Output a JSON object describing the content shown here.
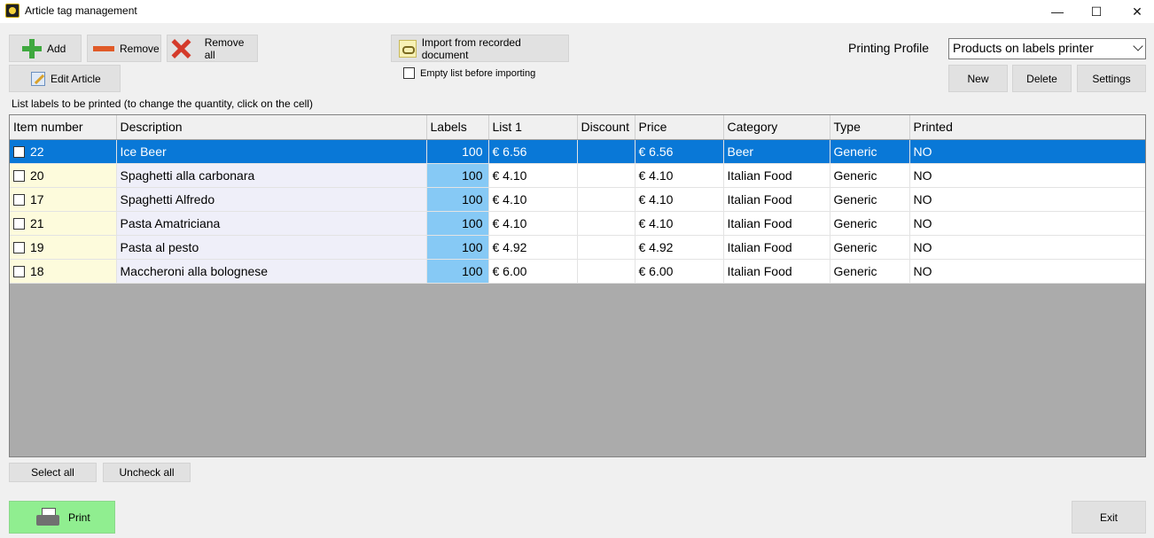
{
  "window": {
    "title": "Article tag management",
    "minimize": "—",
    "maximize": "☐",
    "close": "✕"
  },
  "toolbar": {
    "add": "Add",
    "remove": "Remove",
    "remove_all": "Remove all",
    "edit_article": "Edit Article",
    "import": "Import from recorded document",
    "empty_list": "Empty list before importing"
  },
  "profile": {
    "label": "Printing Profile",
    "selected": "Products on labels printer",
    "new": "New",
    "delete": "Delete",
    "settings": "Settings"
  },
  "list_caption": "List labels to be printed (to change the quantity, click on the cell)",
  "table": {
    "headers": [
      "Item number",
      "Description",
      "Labels",
      "List 1",
      "Discount",
      "Price",
      "Category",
      "Type",
      "Printed"
    ],
    "rows": [
      {
        "item": "22",
        "desc": "Ice Beer",
        "labels": "100",
        "list1": "€ 6.56",
        "discount": "",
        "price": "€ 6.56",
        "category": "Beer",
        "type": "Generic",
        "printed": "NO"
      },
      {
        "item": "20",
        "desc": "Spaghetti alla carbonara",
        "labels": "100",
        "list1": "€ 4.10",
        "discount": "",
        "price": "€ 4.10",
        "category": "Italian Food",
        "type": "Generic",
        "printed": "NO"
      },
      {
        "item": "17",
        "desc": "Spaghetti Alfredo",
        "labels": "100",
        "list1": "€ 4.10",
        "discount": "",
        "price": "€ 4.10",
        "category": "Italian Food",
        "type": "Generic",
        "printed": "NO"
      },
      {
        "item": "21",
        "desc": "Pasta Amatriciana",
        "labels": "100",
        "list1": "€ 4.10",
        "discount": "",
        "price": "€ 4.10",
        "category": "Italian Food",
        "type": "Generic",
        "printed": "NO"
      },
      {
        "item": "19",
        "desc": "Pasta al pesto",
        "labels": "100",
        "list1": "€ 4.92",
        "discount": "",
        "price": "€ 4.92",
        "category": "Italian Food",
        "type": "Generic",
        "printed": "NO"
      },
      {
        "item": "18",
        "desc": "Maccheroni alla bolognese",
        "labels": "100",
        "list1": "€ 6.00",
        "discount": "",
        "price": "€ 6.00",
        "category": "Italian Food",
        "type": "Generic",
        "printed": "NO"
      }
    ]
  },
  "footer": {
    "select_all": "Select all",
    "uncheck_all": "Uncheck all",
    "print": "Print",
    "exit": "Exit"
  },
  "colors": {
    "selection": "#0978d7",
    "labels_cell": "#86c9f5",
    "print_button": "#90ee90",
    "item_cell": "#fdfbdc",
    "desc_cell": "#efeff9",
    "empty_grid": "#ababab"
  }
}
